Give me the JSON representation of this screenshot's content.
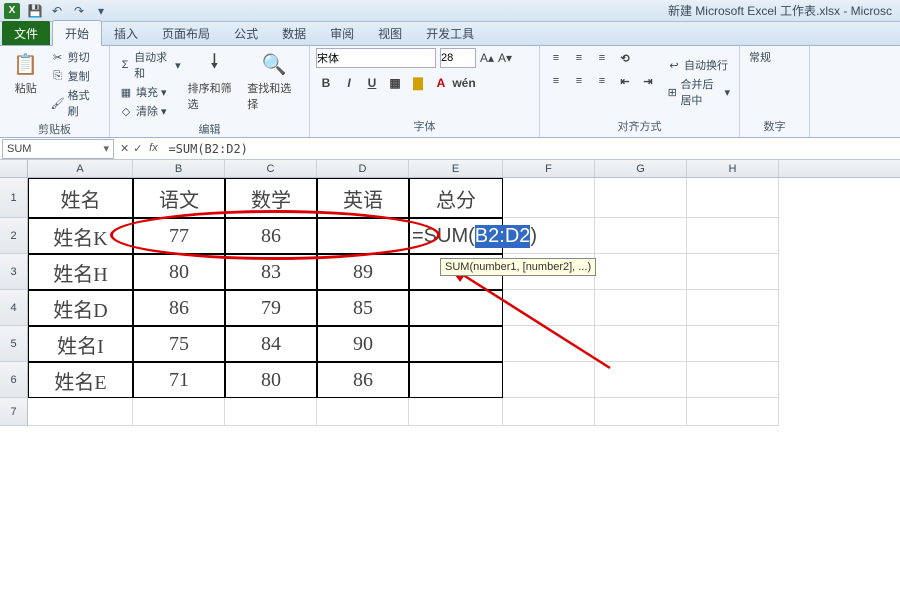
{
  "titlebar": {
    "logo": "X",
    "title": "新建 Microsoft Excel 工作表.xlsx - Microsc"
  },
  "tabs": {
    "file": "文件",
    "home": "开始",
    "insert": "插入",
    "layout": "页面布局",
    "formulas": "公式",
    "data": "数据",
    "review": "审阅",
    "view": "视图",
    "dev": "开发工具"
  },
  "ribbon": {
    "clipboard": {
      "label": "剪贴板",
      "paste": "粘贴",
      "cut": "剪切",
      "copy": "复制",
      "painter": "格式刷"
    },
    "editing": {
      "label": "编辑",
      "autosum": "自动求和",
      "fill": "填充",
      "clear": "清除",
      "sort": "排序和筛选",
      "find": "查找和选择"
    },
    "font": {
      "label": "字体",
      "name": "宋体",
      "size": "28"
    },
    "align": {
      "label": "对齐方式",
      "wrap": "自动换行",
      "merge": "合并后居中"
    },
    "number": {
      "label": "数字",
      "general": "常规"
    }
  },
  "namebox": "SUM",
  "formula": "=SUM(B2:D2)",
  "columns": [
    "A",
    "B",
    "C",
    "D",
    "E",
    "F",
    "G",
    "H"
  ],
  "rows": [
    "1",
    "2",
    "3",
    "4",
    "5",
    "6",
    "7"
  ],
  "table": {
    "headers": {
      "A": "姓名",
      "B": "语文",
      "C": "数学",
      "D": "英语",
      "E": "总分"
    },
    "r2": {
      "A": "姓名K",
      "B": "77",
      "C": "86",
      "D": ""
    },
    "r3": {
      "A": "姓名H",
      "B": "80",
      "C": "83",
      "D": "89"
    },
    "r4": {
      "A": "姓名D",
      "B": "86",
      "C": "79",
      "D": "85"
    },
    "r5": {
      "A": "姓名I",
      "B": "75",
      "C": "84",
      "D": "90"
    },
    "r6": {
      "A": "姓名E",
      "B": "71",
      "C": "80",
      "D": "86"
    }
  },
  "editing": {
    "prefix": "=SUM(",
    "range": "B2:D2",
    "suffix": ")"
  },
  "tooltip": "SUM(number1, [number2], ...)"
}
